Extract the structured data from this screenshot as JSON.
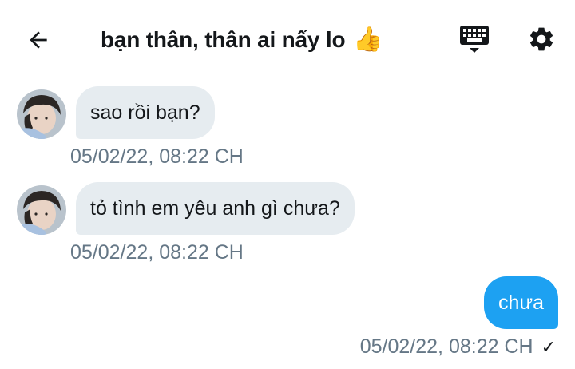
{
  "header": {
    "title": "bạn thân, thân ai nấy lo",
    "title_emoji": "👍"
  },
  "messages": [
    {
      "direction": "incoming",
      "text": "sao rồi bạn?",
      "timestamp": "05/02/22, 08:22 CH"
    },
    {
      "direction": "incoming",
      "text": "tỏ tình em yêu anh gì chưa?",
      "timestamp": "05/02/22, 08:22 CH"
    },
    {
      "direction": "outgoing",
      "text": "chưa",
      "timestamp": "05/02/22, 08:22 CH",
      "status": "✓"
    }
  ],
  "colors": {
    "accent": "#1da1f2",
    "incoming_bubble": "#e6ecf0",
    "timestamp": "#657786",
    "text": "#14171a"
  },
  "icons": {
    "back": "arrow-left-icon",
    "keyboard": "keyboard-icon",
    "settings": "gear-icon"
  }
}
